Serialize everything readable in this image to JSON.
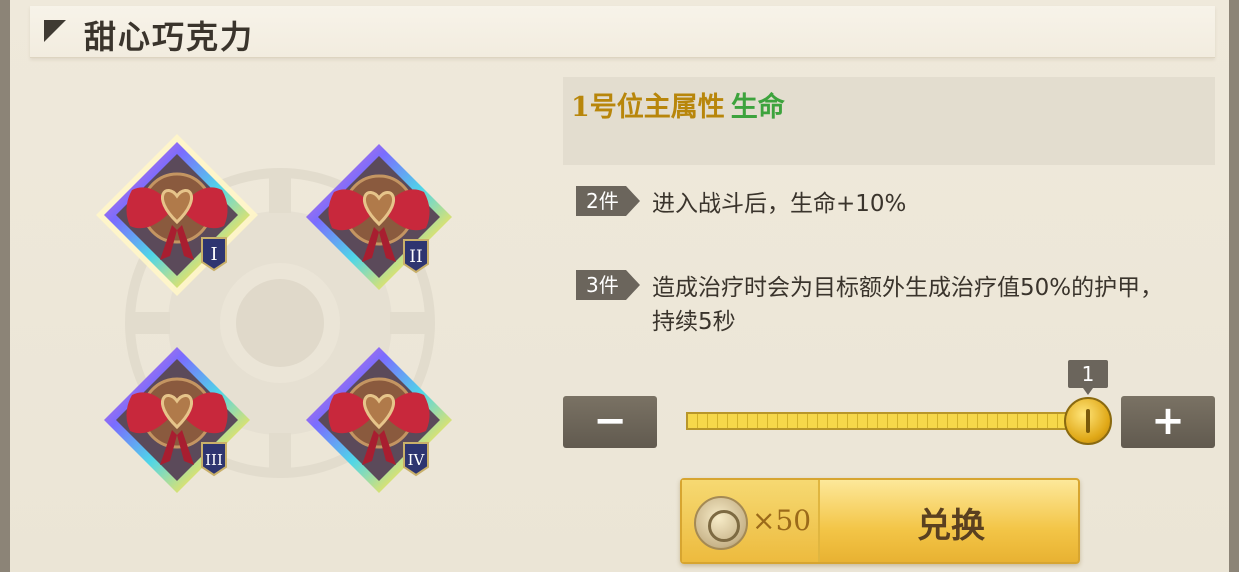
{
  "header": {
    "title": "甜心巧克力"
  },
  "pieces": [
    {
      "numeral": "I",
      "selected": true
    },
    {
      "numeral": "II",
      "selected": false
    },
    {
      "numeral": "III",
      "selected": false
    },
    {
      "numeral": "IV",
      "selected": false
    }
  ],
  "main_attr": {
    "label": "1号位主属性",
    "value": "生命"
  },
  "set_bonuses": [
    {
      "tag": "2件",
      "text": "进入战斗后，生命+10%"
    },
    {
      "tag": "3件",
      "text": "造成治疗时会为目标额外生成治疗值50%的护甲，持续5秒"
    }
  ],
  "quantity": {
    "count": "1",
    "minus": "−",
    "plus": "+"
  },
  "exchange": {
    "cost": "×50",
    "label": "兑换"
  },
  "colors": {
    "gold": "#b8860b",
    "green": "#3da33d",
    "dark_tag": "#6b655c"
  }
}
